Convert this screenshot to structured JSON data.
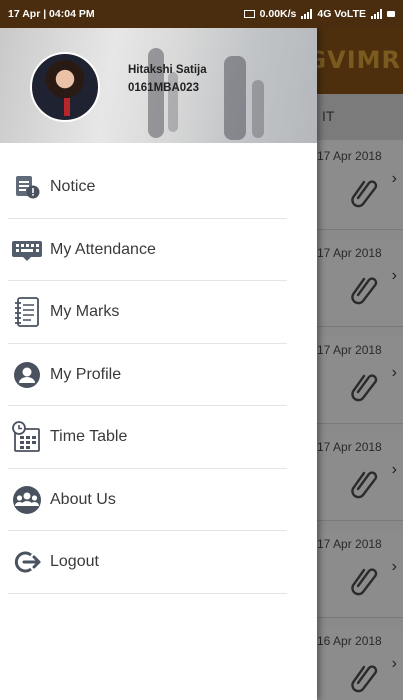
{
  "status_bar": {
    "time": "17 Apr | 04:04 PM",
    "speed": "0.00K/s",
    "network": "4G VoLTE"
  },
  "background_app": {
    "logo": "GVIMR",
    "tab_label": "IT",
    "cards": [
      {
        "date": "17 Apr 2018"
      },
      {
        "date": "17 Apr 2018"
      },
      {
        "date": "17 Apr 2018"
      },
      {
        "date": "17 Apr 2018"
      },
      {
        "date": "17 Apr 2018"
      },
      {
        "date": "16 Apr 2018"
      }
    ]
  },
  "drawer": {
    "user_name": "Hitakshi Satija",
    "user_id": "0161MBA023",
    "menu": [
      {
        "label": "Notice",
        "icon": "notice-icon"
      },
      {
        "label": "My Attendance",
        "icon": "attendance-icon"
      },
      {
        "label": "My Marks",
        "icon": "marks-icon"
      },
      {
        "label": "My Profile",
        "icon": "profile-icon"
      },
      {
        "label": "Time Table",
        "icon": "timetable-icon"
      },
      {
        "label": "About Us",
        "icon": "about-us-icon"
      },
      {
        "label": "Logout",
        "icon": "logout-icon"
      }
    ]
  }
}
